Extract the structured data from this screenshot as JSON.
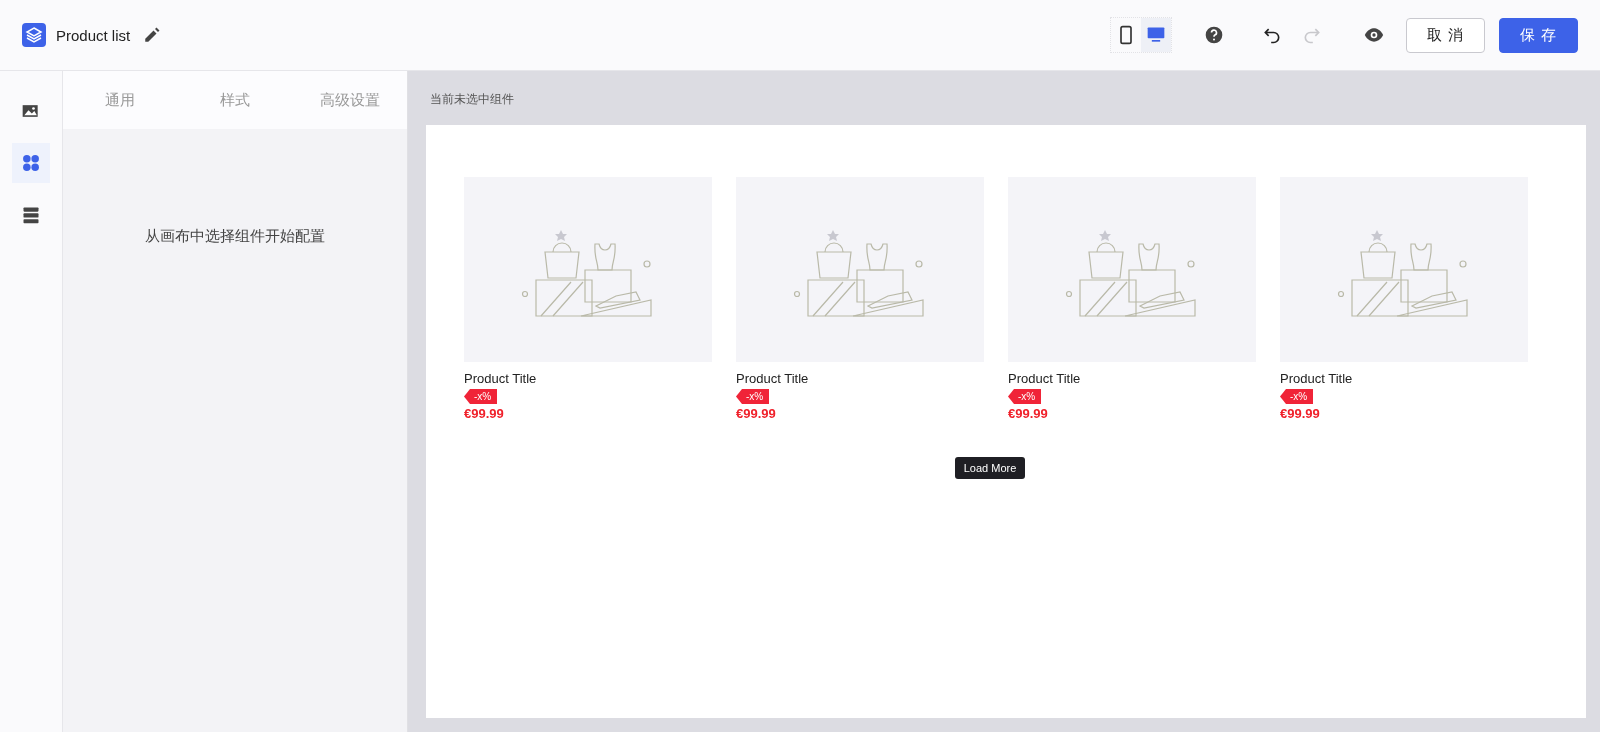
{
  "header": {
    "title": "Product list",
    "devices": [
      {
        "kind": "mobile",
        "selected": false
      },
      {
        "kind": "desktop",
        "selected": true
      }
    ],
    "history": [
      {
        "kind": "undo",
        "disabled": false
      },
      {
        "kind": "redo",
        "disabled": true
      }
    ],
    "cancel": "取 消",
    "save": "保 存"
  },
  "rail": [
    {
      "kind": "media",
      "selected": false
    },
    {
      "kind": "components",
      "selected": true
    },
    {
      "kind": "layers",
      "selected": false
    }
  ],
  "panel": {
    "tabs": [
      "通用",
      "样式",
      "高级设置"
    ],
    "empty_message": "从画布中选择组件开始配置"
  },
  "canvas": {
    "status": "当前未选中组件",
    "products": [
      {
        "title": "Product Title",
        "tag": "-x%",
        "price": "€99.99"
      },
      {
        "title": "Product Title",
        "tag": "-x%",
        "price": "€99.99"
      },
      {
        "title": "Product Title",
        "tag": "-x%",
        "price": "€99.99"
      },
      {
        "title": "Product Title",
        "tag": "-x%",
        "price": "€99.99"
      }
    ],
    "load_more": "Load More"
  }
}
